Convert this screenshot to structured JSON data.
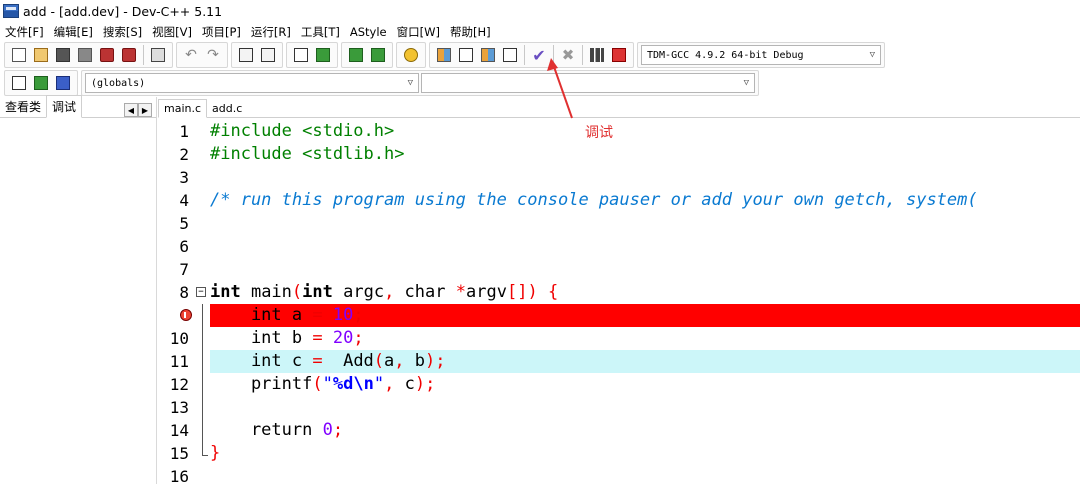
{
  "window": {
    "title": "add - [add.dev] - Dev-C++ 5.11"
  },
  "menu": [
    "文件[F]",
    "编辑[E]",
    "搜索[S]",
    "视图[V]",
    "项目[P]",
    "运行[R]",
    "工具[T]",
    "AStyle",
    "窗口[W]",
    "帮助[H]"
  ],
  "toolbar": {
    "compiler_select": "TDM-GCC 4.9.2 64-bit Debug",
    "scope_select": "(globals)",
    "function_select": ""
  },
  "left_panel": {
    "tabs": [
      "查看类",
      "调试"
    ]
  },
  "editor": {
    "tabs": [
      "main.c",
      "add.c"
    ],
    "line_numbers": [
      "1",
      "2",
      "3",
      "4",
      "5",
      "6",
      "7",
      "8",
      "9",
      "10",
      "11",
      "12",
      "13",
      "14",
      "15",
      "16"
    ],
    "lines": [
      "#include <stdio.h>",
      "#include <stdlib.h>",
      "",
      "/* run this program using the console pauser or add your own getch, system(",
      "",
      "",
      "",
      "int main(int argc, char *argv[]) {",
      "    int a = 10;",
      "    int b = 20;",
      "    int c =  Add(a, b);",
      "    printf(\"%d\\n\", c);",
      "",
      "    return 0;",
      "}",
      ""
    ]
  },
  "annotation": {
    "label": "调试"
  }
}
